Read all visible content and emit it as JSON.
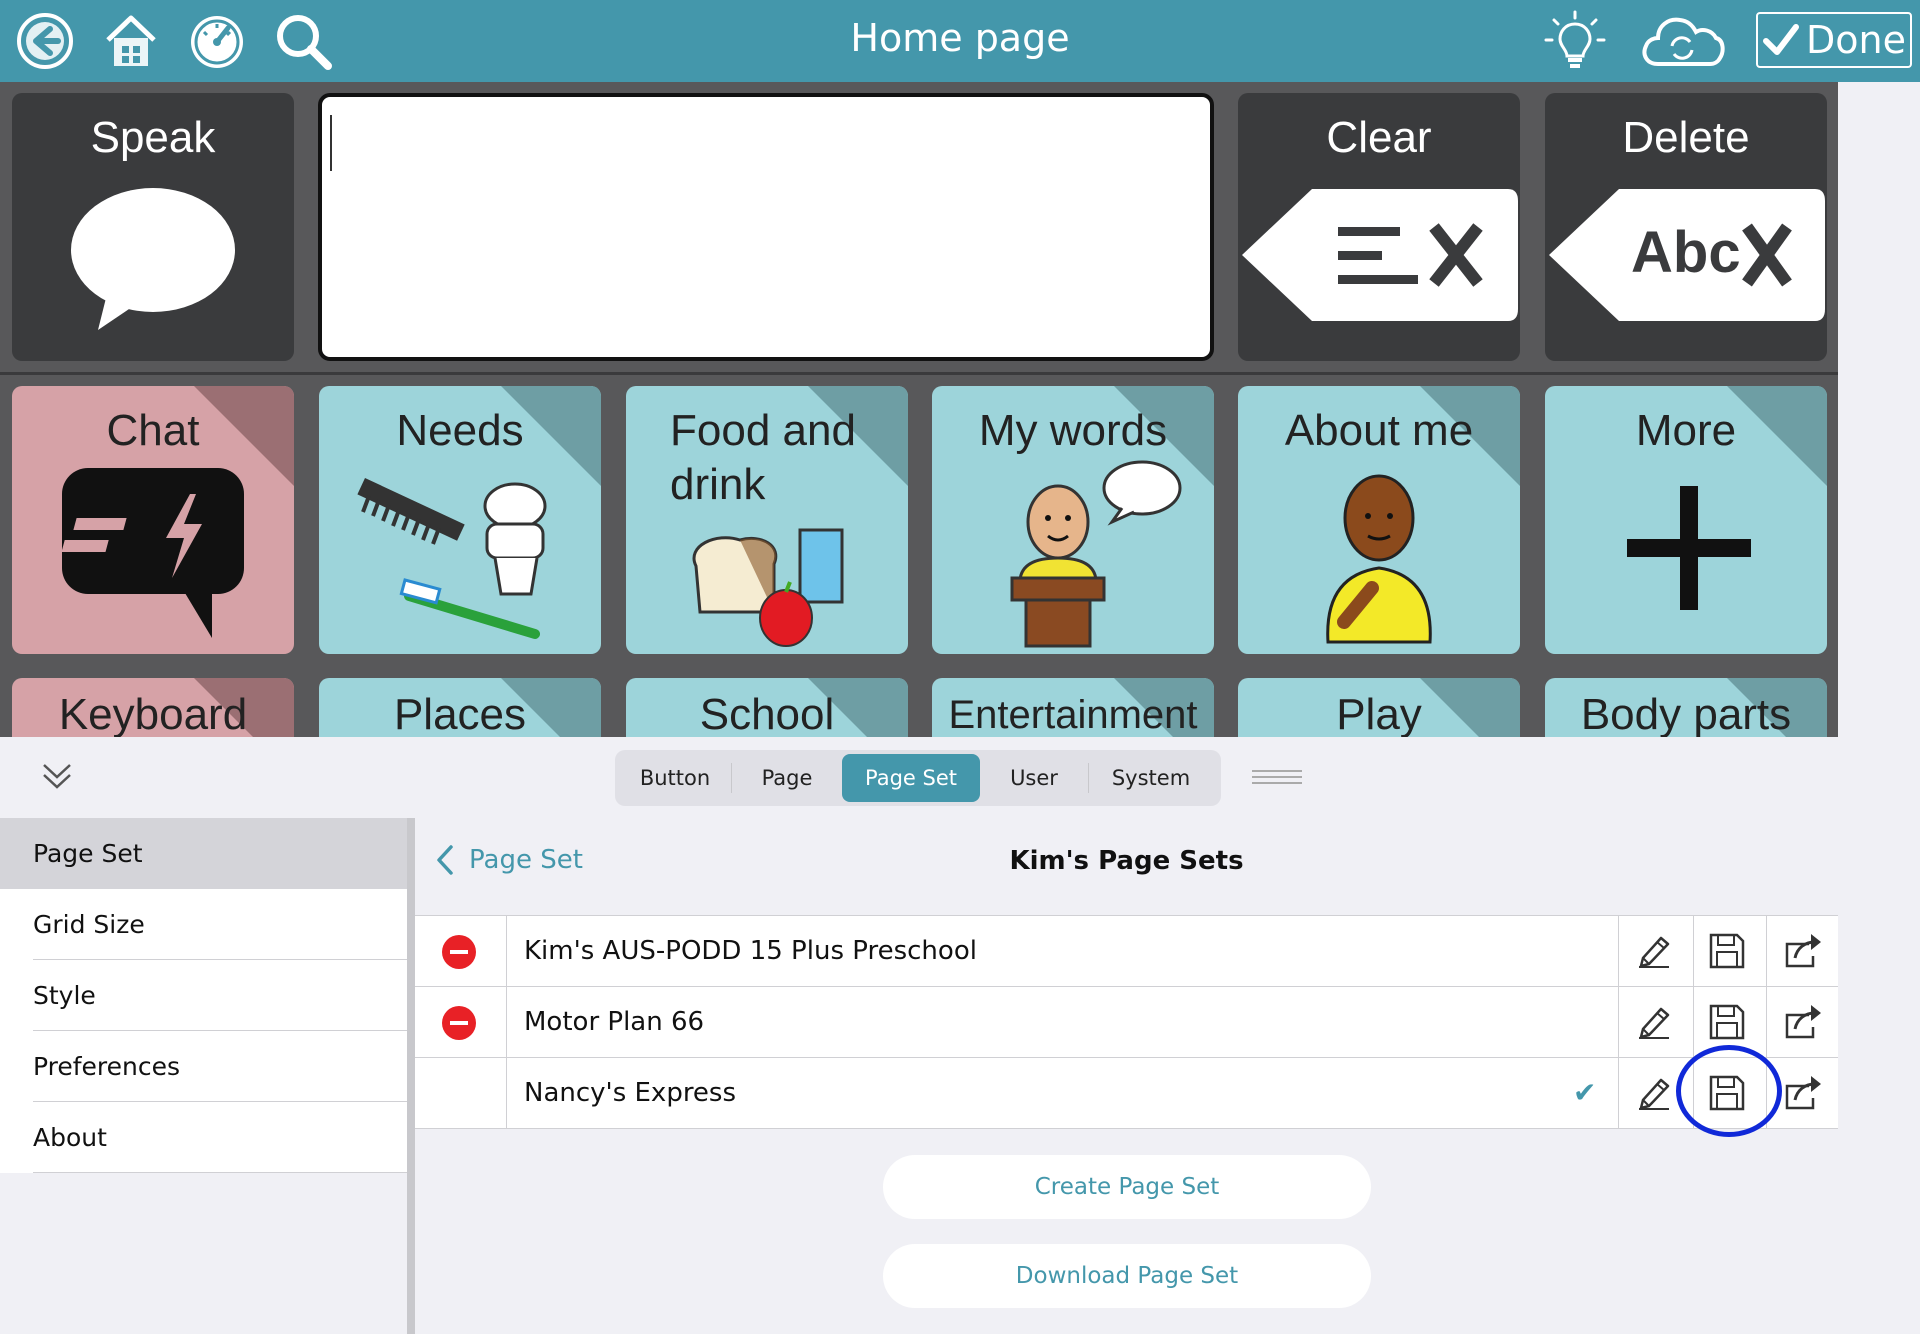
{
  "topbar": {
    "title": "Home page",
    "done_label": "Done",
    "icons": [
      "back-arrow-icon",
      "home-icon",
      "dashboard-icon",
      "search-icon",
      "lightbulb-icon",
      "cloud-sync-icon",
      "checkmark-icon"
    ]
  },
  "grid": {
    "row1": {
      "speak": "Speak",
      "clear": "Clear",
      "delete": "Delete",
      "delete_glyph": "Abc"
    },
    "row2": [
      "Chat",
      "Needs",
      "Food and\ndrink",
      "My words",
      "About me",
      "More"
    ],
    "row3": [
      "Keyboard",
      "Places",
      "School",
      "Entertainment",
      "Play",
      "Body parts"
    ]
  },
  "tabs": {
    "items": [
      "Button",
      "Page",
      "Page Set",
      "User",
      "System"
    ],
    "selected": "Page Set"
  },
  "sidebar": {
    "items": [
      "Page Set",
      "Grid Size",
      "Style",
      "Preferences",
      "About"
    ],
    "selected": "Page Set"
  },
  "content": {
    "back_label": "Page Set",
    "title": "Kim's Page Sets",
    "page_sets": [
      {
        "name": "Kim's AUS-PODD 15 Plus Preschool",
        "deletable": true,
        "checked": false
      },
      {
        "name": "Motor Plan 66",
        "deletable": true,
        "checked": false
      },
      {
        "name": "Nancy's Express",
        "deletable": false,
        "checked": true
      }
    ],
    "create_label": "Create Page Set",
    "download_label": "Download Page Set"
  },
  "colors": {
    "accent": "#4497ab",
    "cell_blue": "#9dd4da",
    "cell_pink": "#d6a2a7",
    "cell_dark": "#3a3b3d",
    "delete_red": "#e82126",
    "highlight_ring": "#1029d8"
  }
}
